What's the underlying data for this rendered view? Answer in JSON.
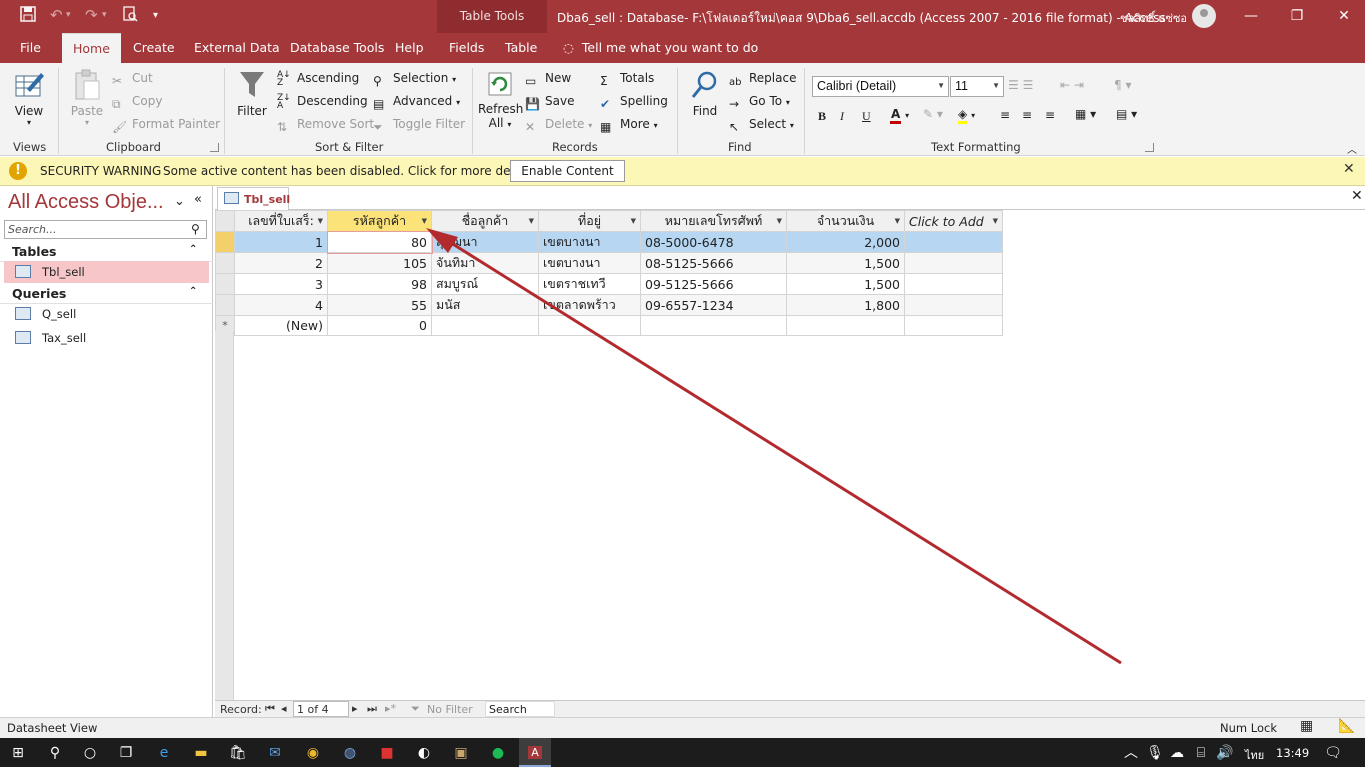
{
  "titlebar": {
    "context_label": "Table Tools",
    "doc_title": "Dba6_sell : Database- F:\\โฟลเดอร์ใหม่\\คอส 9\\Dba6_sell.accdb (Access 2007 - 2016 file format)  -  Access",
    "user_name": "ชลสิทธิ์ แซ่ซอ",
    "qat_icons": [
      "save-icon",
      "undo-icon",
      "redo-icon",
      "print-preview-icon",
      "customize-icon"
    ]
  },
  "tabs": {
    "file": "File",
    "home": "Home",
    "create": "Create",
    "external": "External Data",
    "dbtools": "Database Tools",
    "help": "Help",
    "fields": "Fields",
    "table": "Table",
    "tellme": "Tell me what you want to do"
  },
  "ribbon": {
    "views": {
      "view": "View",
      "label": "Views"
    },
    "clipboard": {
      "paste": "Paste",
      "cut": "Cut",
      "copy": "Copy",
      "format_painter": "Format Painter",
      "label": "Clipboard"
    },
    "sort_filter": {
      "filter": "Filter",
      "ascending": "Ascending",
      "descending": "Descending",
      "remove_sort": "Remove Sort",
      "selection": "Selection",
      "advanced": "Advanced",
      "toggle_filter": "Toggle Filter",
      "label": "Sort & Filter"
    },
    "records": {
      "refresh_1": "Refresh",
      "refresh_2": "All",
      "new": "New",
      "save": "Save",
      "delete": "Delete",
      "totals": "Totals",
      "spelling": "Spelling",
      "more": "More",
      "label": "Records"
    },
    "find": {
      "find": "Find",
      "replace": "Replace",
      "goto": "Go To",
      "select": "Select",
      "label": "Find"
    },
    "text_formatting": {
      "font": "Calibri (Detail)",
      "size": "11",
      "bold": "B",
      "italic": "I",
      "underline": "U",
      "label": "Text Formatting",
      "font_color": "#c00000",
      "highlight_color": "#ffff00"
    }
  },
  "security": {
    "title": "SECURITY WARNING",
    "message": "Some active content has been disabled. Click for more details.",
    "button": "Enable Content"
  },
  "nav": {
    "title": "All Access Obje...",
    "search_placeholder": "Search...",
    "tables_header": "Tables",
    "tables": [
      "Tbl_sell"
    ],
    "queries_header": "Queries",
    "queries": [
      "Q_sell",
      "Tax_sell"
    ]
  },
  "document": {
    "tab": "Tbl_sell",
    "columns": [
      "เลขที่ใบเสร็:",
      "รหัสลูกค้า",
      "ชื่อลูกค้า",
      "ที่อยู่",
      "หมายเลขโทรศัพท์",
      "จำนวนเงิน",
      "Click to Add"
    ],
    "rows": [
      [
        "1",
        "80",
        "สุวัฒนา",
        "เขตบางนา",
        "08-5000-6478",
        "2,000"
      ],
      [
        "2",
        "105",
        "จันทิมา",
        "เขตบางนา",
        "08-5125-5666",
        "1,500"
      ],
      [
        "3",
        "98",
        "สมบูรณ์",
        "เขตราชเทวี",
        "09-5125-5666",
        "1,500"
      ],
      [
        "4",
        "55",
        "มนัส",
        "เขตลาดพร้าว",
        "09-6557-1234",
        "1,800"
      ]
    ],
    "new_row": {
      "marker": "*",
      "id": "(New)",
      "customer_id": "0"
    }
  },
  "record_nav": {
    "label": "Record:",
    "position": "1 of 4",
    "no_filter": "No Filter",
    "search": "Search"
  },
  "status": {
    "view": "Datasheet View",
    "numlock": "Num Lock"
  },
  "taskbar": {
    "lang": "ไทย",
    "time": "13:49"
  },
  "annotation": {
    "arrow_color": "#b22a2e"
  }
}
